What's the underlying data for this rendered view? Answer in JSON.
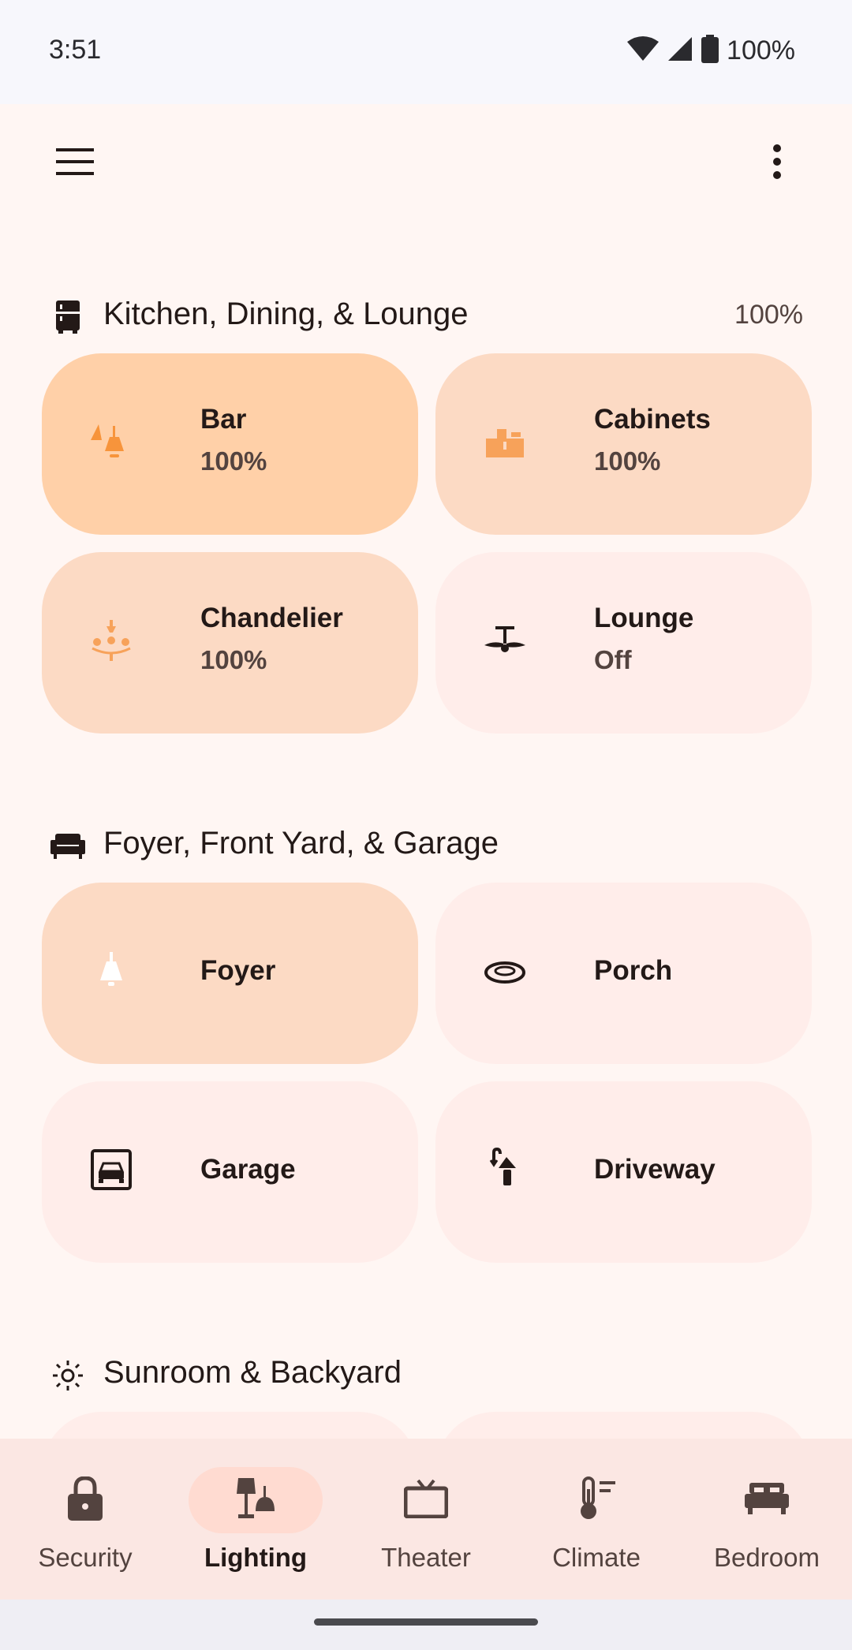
{
  "status_bar": {
    "time": "3:51",
    "battery": "100%",
    "icons": [
      "wifi-icon",
      "cell-signal-icon",
      "battery-icon"
    ]
  },
  "topbar": {
    "menu_icon": "menu-icon",
    "more_icon": "more-vert-icon"
  },
  "sections": [
    {
      "title": "Kitchen, Dining, & Lounge",
      "percent": "100%",
      "icon": "fridge-icon",
      "tiles": [
        {
          "name": "Bar",
          "value": "100%",
          "icon": "pendant-light-icon",
          "state": "on"
        },
        {
          "name": "Cabinets",
          "value": "100%",
          "icon": "cabinet-light-icon",
          "state": "on"
        },
        {
          "name": "Chandelier",
          "value": "100%",
          "icon": "chandelier-icon",
          "state": "on"
        },
        {
          "name": "Lounge",
          "value": "Off",
          "icon": "ceiling-fan-icon",
          "state": "off"
        }
      ]
    },
    {
      "title": "Foyer, Front Yard, & Garage",
      "icon": "sofa-icon",
      "tiles": [
        {
          "name": "Foyer",
          "icon": "bell-light-icon",
          "state": "on"
        },
        {
          "name": "Porch",
          "icon": "ring-light-icon",
          "state": "off"
        },
        {
          "name": "Garage",
          "icon": "garage-icon",
          "state": "off"
        },
        {
          "name": "Driveway",
          "icon": "outdoor-lamp-icon",
          "state": "off"
        }
      ]
    },
    {
      "title": "Sunroom & Backyard",
      "icon": "sun-icon"
    }
  ],
  "nav": [
    {
      "label": "Security",
      "icon": "lock-icon",
      "active": false
    },
    {
      "label": "Lighting",
      "icon": "lamp-icon",
      "active": true
    },
    {
      "label": "Theater",
      "icon": "tv-icon",
      "active": false
    },
    {
      "label": "Climate",
      "icon": "thermostat-icon",
      "active": false
    },
    {
      "label": "Bedroom",
      "icon": "bed-icon",
      "active": false
    }
  ],
  "colors": {
    "tile_on_strong": "#ffd0a8",
    "tile_on": "#fcdac4",
    "tile_off": "#ffedea",
    "accent_orange": "#f7943b",
    "nav_active_pill": "#ffdbd1"
  }
}
